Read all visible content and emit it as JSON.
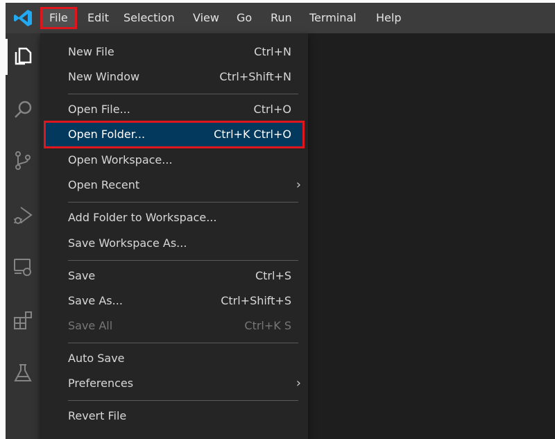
{
  "menubar": {
    "items": [
      {
        "label": "File"
      },
      {
        "label": "Edit"
      },
      {
        "label": "Selection"
      },
      {
        "label": "View"
      },
      {
        "label": "Go"
      },
      {
        "label": "Run"
      },
      {
        "label": "Terminal"
      },
      {
        "label": "Help"
      }
    ]
  },
  "file_menu": {
    "items": [
      {
        "label": "New File",
        "shortcut": "Ctrl+N"
      },
      {
        "label": "New Window",
        "shortcut": "Ctrl+Shift+N"
      },
      {
        "label": "Open File...",
        "shortcut": "Ctrl+O"
      },
      {
        "label": "Open Folder...",
        "shortcut": "Ctrl+K Ctrl+O"
      },
      {
        "label": "Open Workspace...",
        "shortcut": ""
      },
      {
        "label": "Open Recent",
        "shortcut": ""
      },
      {
        "label": "Add Folder to Workspace...",
        "shortcut": ""
      },
      {
        "label": "Save Workspace As...",
        "shortcut": ""
      },
      {
        "label": "Save",
        "shortcut": "Ctrl+S"
      },
      {
        "label": "Save As...",
        "shortcut": "Ctrl+Shift+S"
      },
      {
        "label": "Save All",
        "shortcut": "Ctrl+K S"
      },
      {
        "label": "Auto Save",
        "shortcut": ""
      },
      {
        "label": "Preferences",
        "shortcut": ""
      },
      {
        "label": "Revert File",
        "shortcut": ""
      }
    ],
    "submenu_arrow": "›"
  },
  "colors": {
    "titlebar": "#3c3c3c",
    "activity_bar": "#333333",
    "menu_bg": "#252526",
    "selection": "#04395e",
    "highlight_outline": "#e0161e",
    "vscode_blue": "#23a9f2"
  },
  "activity_bar": {
    "icons": [
      "explorer-icon",
      "search-icon",
      "source-control-icon",
      "run-debug-icon",
      "remote-explorer-icon",
      "extensions-icon",
      "testing-icon"
    ]
  }
}
